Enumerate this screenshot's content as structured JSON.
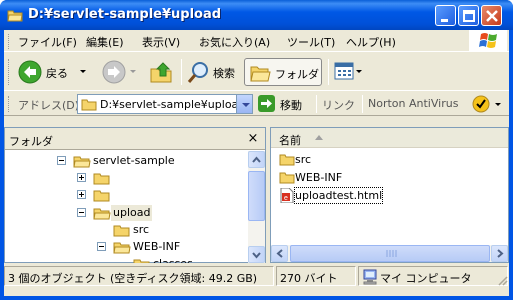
{
  "window": {
    "title": "D:¥servlet-sample¥upload"
  },
  "menu": {
    "items": [
      "ファイル(F)",
      "編集(E)",
      "表示(V)",
      "お気に入り(A)",
      "ツール(T)",
      "ヘルプ(H)"
    ]
  },
  "toolbar": {
    "back_label": "戻る",
    "search_label": "検索",
    "folders_label": "フォルダ"
  },
  "address": {
    "label": "アドレス(D)",
    "value": "D:¥servlet-sample¥upload",
    "go_label": "移動",
    "links_label": "リンク",
    "norton_label": "Norton AntiVirus"
  },
  "folder_pane": {
    "title": "フォルダ",
    "close_glyph": "×",
    "tree": [
      {
        "label": "servlet-sample",
        "expanded": true
      },
      {
        "label": "",
        "expanded": false
      },
      {
        "label": "",
        "expanded": false
      },
      {
        "label": "upload",
        "expanded": true,
        "selected": true
      },
      {
        "label": "src"
      },
      {
        "label": "WEB-INF",
        "expanded": true
      },
      {
        "label": "classes"
      }
    ]
  },
  "file_pane": {
    "column_name": "名前",
    "files": [
      {
        "name": "src",
        "type": "folder"
      },
      {
        "name": "WEB-INF",
        "type": "folder"
      },
      {
        "name": "uploadtest.html",
        "type": "html"
      }
    ]
  },
  "status": {
    "objects": "3 個のオブジェクト (空きディスク領域: 49.2 GB)",
    "size": "270 バイト",
    "location": "マイ コンピュータ"
  },
  "colors": {
    "title_bar": "#0055e5",
    "chrome": "#ece9d8",
    "folder": "#f5d46a"
  }
}
